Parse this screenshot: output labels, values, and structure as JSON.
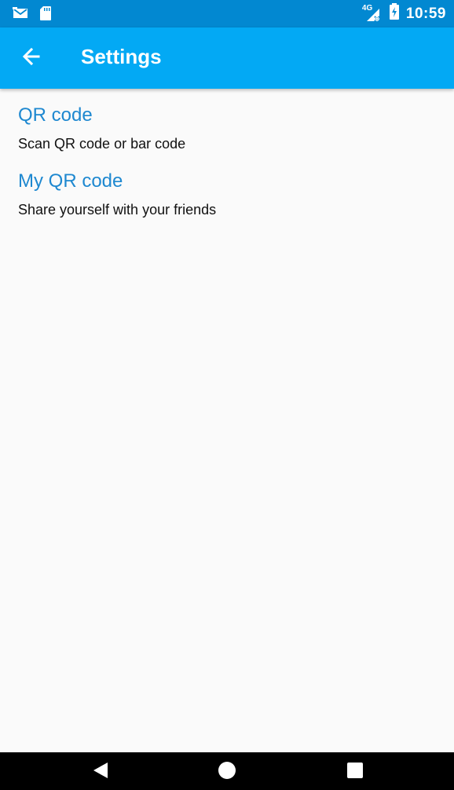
{
  "status_bar": {
    "left_icons": [
      "mail-icon",
      "sd-card-icon"
    ],
    "network_label": "4G",
    "time": "10:59"
  },
  "app_bar": {
    "title": "Settings",
    "back_icon": "arrow-back-icon"
  },
  "preferences": [
    {
      "title": "QR code",
      "summary": "Scan QR code or bar code"
    },
    {
      "title": "My QR code",
      "summary": "Share yourself with your friends"
    }
  ],
  "nav_bar": {
    "buttons": [
      "back-triangle-icon",
      "home-circle-icon",
      "recents-square-icon"
    ]
  },
  "colors": {
    "status_bar": "#0288d1",
    "app_bar": "#03a9f4",
    "pref_title": "#1e88d0",
    "background": "#fafafa"
  }
}
